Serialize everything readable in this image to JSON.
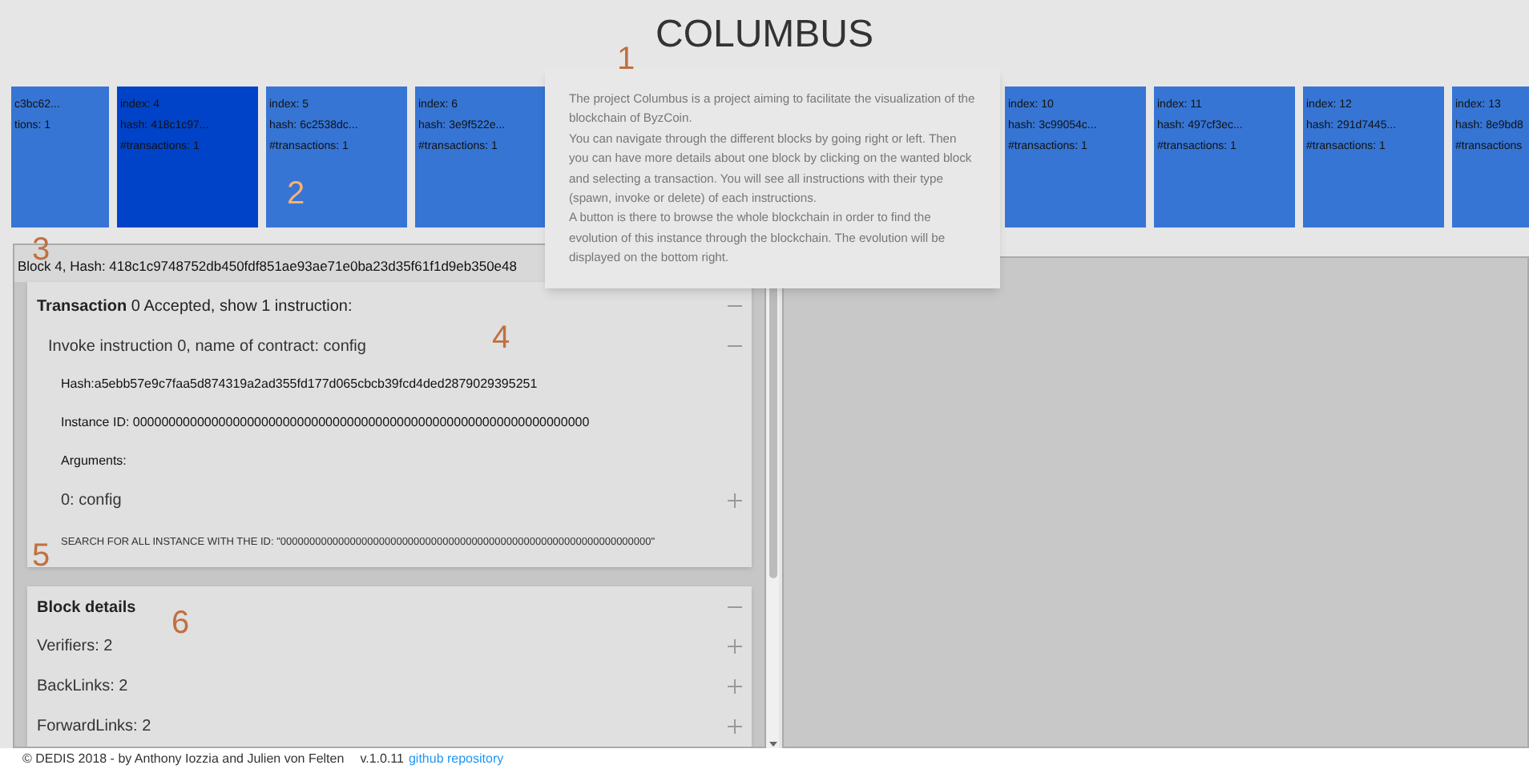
{
  "title": "COLUMBUS",
  "blocks": [
    {
      "hash": "c3bc62...",
      "transactions": "tions: 1",
      "selected": false
    },
    {
      "index": "index: 4",
      "hash": "hash: 418c1c97...",
      "transactions": "#transactions: 1",
      "selected": true
    },
    {
      "index": "index: 5",
      "hash": "hash: 6c2538dc...",
      "transactions": "#transactions: 1",
      "selected": false
    },
    {
      "index": "index: 6",
      "hash": "hash: 3e9f522e...",
      "transactions": "#transactions: 1",
      "selected": false
    },
    {
      "index": "index: 10",
      "hash": "hash: 3c99054c...",
      "transactions": "#transactions: 1",
      "selected": false
    },
    {
      "index": "index: 11",
      "hash": "hash: 497cf3ec...",
      "transactions": "#transactions: 1",
      "selected": false
    },
    {
      "index": "index: 12",
      "hash": "hash: 291d7445...",
      "transactions": "#transactions: 1",
      "selected": false
    },
    {
      "index": "index: 13",
      "hash": "hash: 8e9bd8",
      "transactions": "#transactions",
      "selected": false
    }
  ],
  "tooltip": [
    "The project Columbus is a project aiming to facilitate the visualization of the blockchain of ByzCoin.",
    "You can navigate through the different blocks by going right or left. Then you can have more details about one block by clicking on the wanted block and selecting a transaction. You will see all instructions with their type (spawn, invoke or delete) of each instructions.",
    "A button is there to browse the whole blockchain in order to find the evolution of this instance through the blockchain. The evolution will be displayed on the bottom right."
  ],
  "block_header": "Block 4, Hash: 418c1c9748752db450fdf851ae93ae71e0ba23d35f61f1d9eb350e48",
  "transaction": {
    "title": "**Transaction** 0 Accepted, show 1 instruction:",
    "expanded": true,
    "instruction": {
      "title": "Invoke instruction 0, name of contract: config",
      "expanded": true,
      "hash": "Hash:a5ebb57e9c7faa5d874319a2ad355fd177d065cbcb39fcd4ded2879029395251",
      "instance_id": "Instance ID: 0000000000000000000000000000000000000000000000000000000000000000",
      "arguments_label": "Arguments:",
      "arguments": [
        {
          "label": "0: config",
          "expanded": false
        }
      ]
    },
    "search_button": "SEARCH FOR ALL INSTANCE WITH THE ID: \"0000000000000000000000000000000000000000000000000000000000000000\""
  },
  "block_details": {
    "title": "Block details",
    "expanded": true,
    "items": [
      {
        "label": "Verifiers: 2",
        "expanded": false
      },
      {
        "label": "BackLinks: 2",
        "expanded": false
      },
      {
        "label": "ForwardLinks: 2",
        "expanded": false
      }
    ]
  },
  "footer": {
    "credit": "© DEDIS 2018 - by Anthony Iozzia and Julien von Felten",
    "version": "v.1.0.11",
    "link": "github repository"
  },
  "callouts": [
    "1",
    "2",
    "3",
    "4",
    "5",
    "6"
  ]
}
